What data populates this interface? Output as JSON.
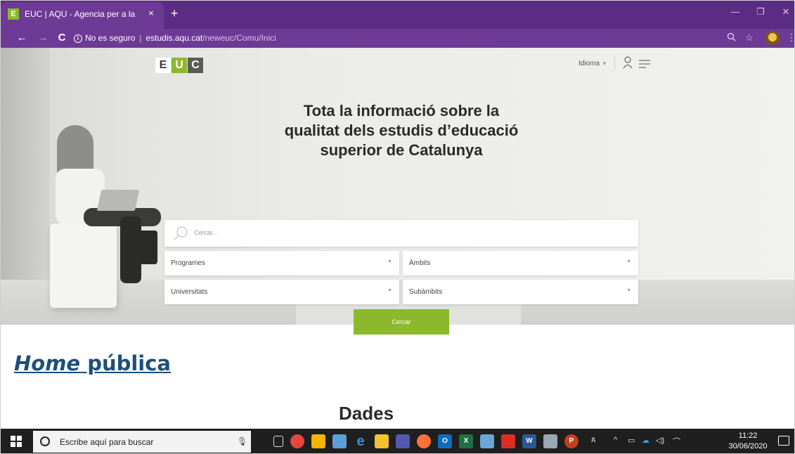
{
  "browser": {
    "tab_favicon": "E",
    "tab_title": "EUC | AQU - Agencia per a la Qu",
    "tab_close_icon": "×",
    "new_tab_icon": "+",
    "window_controls": {
      "minimize": "—",
      "restore": "❐",
      "close": "✕"
    },
    "nav": {
      "back": "←",
      "forward": "→",
      "reload": "C"
    },
    "address": {
      "security_label": "No es seguro",
      "url_host": "estudis.aqu.cat",
      "url_path": "/neweuc/Comu/Inici"
    },
    "toolbar_icons": {
      "zoom": "zoom-icon",
      "bookmark": "☆",
      "menu": "⋮"
    }
  },
  "site": {
    "logo_letters": [
      "E",
      "U",
      "C"
    ],
    "language_label": "Idioma",
    "hero_title_line1": "Tota la informació sobre la",
    "hero_title_line2": "qualitat dels estudis d’educació",
    "hero_title_line3": "superior de Catalunya",
    "search_placeholder": "Cercar...",
    "filters": {
      "programes": "Programes",
      "ambits": "Àmbits",
      "universitats": "Universitats",
      "subambits": "Subàmbits"
    },
    "search_button": "Cercar",
    "section_title": "Dades"
  },
  "slide": {
    "title_italic": "Home",
    "title_rest": " pública"
  },
  "taskbar": {
    "search_placeholder": "Escribe aquí para buscar",
    "time": "11:22",
    "date": "30/06/2020"
  },
  "colors": {
    "browser_frame": "#5b2c83",
    "brand_green": "#8bb92b",
    "slide_title": "#1f4e79"
  }
}
